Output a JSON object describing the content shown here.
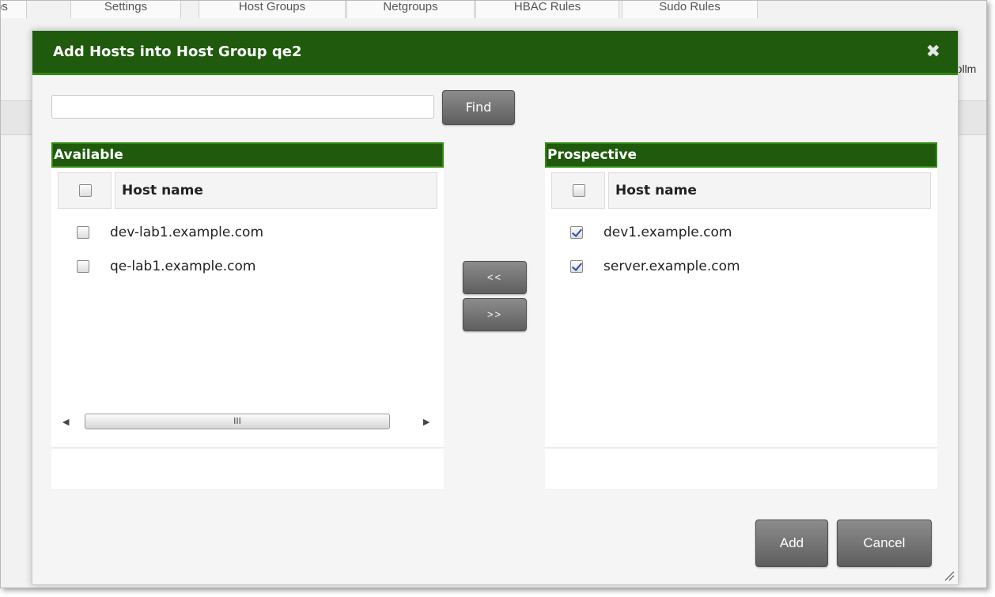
{
  "background": {
    "tabs": [
      "ps",
      "Settings",
      "Host Groups",
      "Netgroups",
      "HBAC Rules",
      "Sudo Rules"
    ],
    "side_text": "rollm"
  },
  "dialog": {
    "title": "Add Hosts into Host Group qe2",
    "close_icon": "close-icon",
    "search": {
      "value": "",
      "placeholder": ""
    },
    "find_label": "Find",
    "available": {
      "header": "Available",
      "column": "Host name",
      "rows": [
        {
          "name": "dev-lab1.example.com",
          "checked": false
        },
        {
          "name": "qe-lab1.example.com",
          "checked": false
        }
      ],
      "scroll_thumb": "III"
    },
    "prospective": {
      "header": "Prospective",
      "column": "Host name",
      "rows": [
        {
          "name": "dev1.example.com",
          "checked": true
        },
        {
          "name": "server.example.com",
          "checked": true
        }
      ]
    },
    "move_left_label": "<<",
    "move_right_label": ">>",
    "add_label": "Add",
    "cancel_label": "Cancel"
  },
  "colors": {
    "header_green": "#1f5a0d",
    "button_gray": "#6f6f6f"
  }
}
